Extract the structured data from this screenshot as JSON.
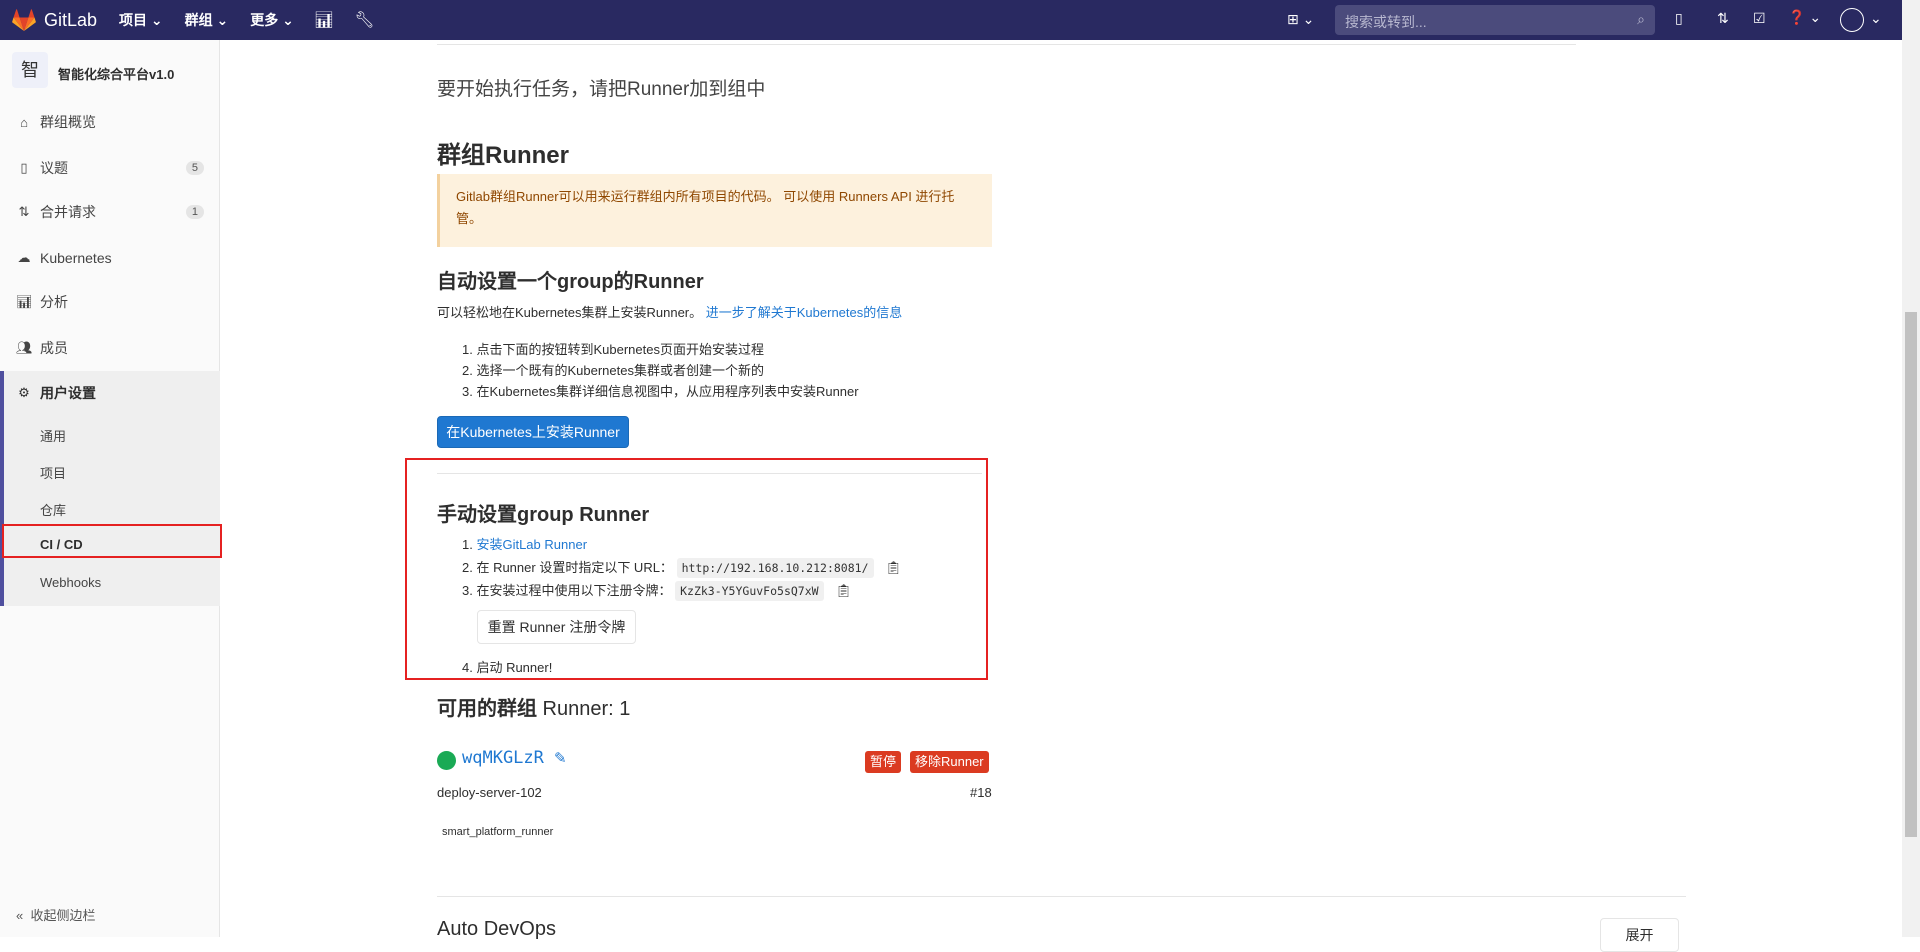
{
  "nav": {
    "brand": "GitLab",
    "projects": "项目",
    "groups": "群组",
    "more": "更多",
    "search_placeholder": "搜索或转到..."
  },
  "sidebar": {
    "avatar_letter": "智",
    "group_name": "智能化综合平台v1.0",
    "items": [
      {
        "label": "群组概览"
      },
      {
        "label": "议题",
        "count": "5"
      },
      {
        "label": "合并请求",
        "count": "1"
      },
      {
        "label": "Kubernetes"
      },
      {
        "label": "分析"
      },
      {
        "label": "成员"
      },
      {
        "label": "用户设置"
      }
    ],
    "sub": [
      "通用",
      "项目",
      "仓库",
      "CI / CD",
      "Webhooks"
    ],
    "collapse": "收起侧边栏"
  },
  "main": {
    "intro": "要开始执行任务，请把Runner加到组中",
    "group_runner_title": "群组Runner",
    "warning": "Gitlab群组Runner可以用来运行群组内所有项目的代码。 可以使用 Runners API 进行托管。",
    "auto_title": "自动设置一个group的Runner",
    "auto_desc": "可以轻松地在Kubernetes集群上安装Runner。",
    "auto_link": "进一步了解关于Kubernetes的信息",
    "auto_steps": [
      "1. 点击下面的按钮转到Kubernetes页面开始安装过程",
      "2. 选择一个既有的Kubernetes集群或者创建一个新的",
      "3. 在Kubernetes集群详细信息视图中，从应用程序列表中安装Runner"
    ],
    "install_button": "在Kubernetes上安装Runner",
    "manual_title": "手动设置group Runner",
    "step1_prefix": "1. ",
    "step1_link": "安装GitLab Runner",
    "step2": "2. 在 Runner 设置时指定以下 URL：",
    "url": "http://192.168.10.212:8081/",
    "step3": "3. 在安装过程中使用以下注册令牌：",
    "token": "KzZk3-Y5YGuvFo5sQ7xW",
    "reset_button": "重置 Runner 注册令牌",
    "step4": "4. 启动 Runner!",
    "available_title_cn": "可用的群组",
    "available_title_en": " Runner: 1",
    "runner": {
      "id": "wqMKGLzR",
      "status_color": "#1aaa55",
      "pause": "暂停",
      "remove": "移除Runner",
      "description": "deploy-server-102",
      "number": "#18",
      "tag": "smart_platform_runner"
    },
    "autodevops_title": "Auto DevOps",
    "expand": "展开"
  }
}
